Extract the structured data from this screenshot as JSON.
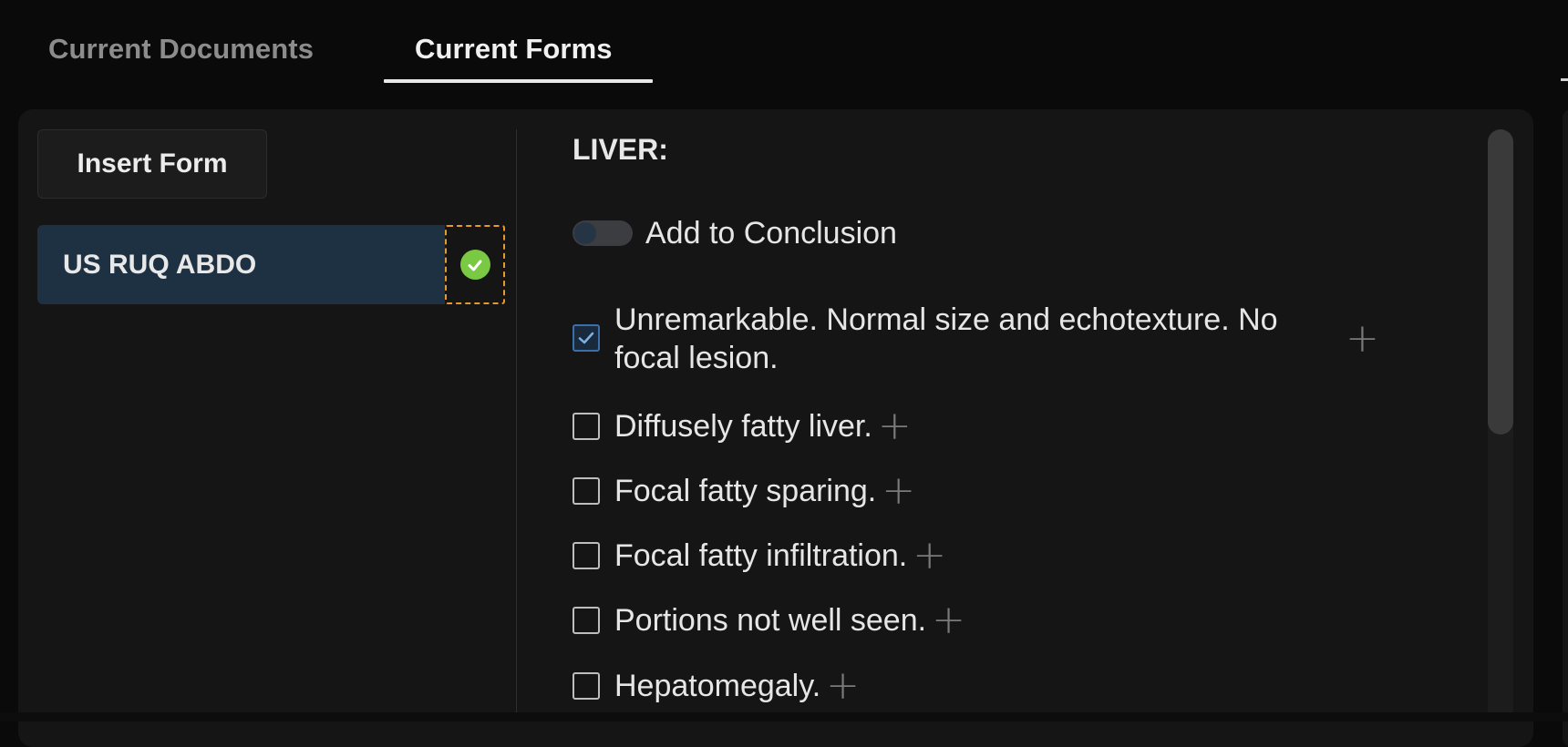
{
  "tabs": [
    {
      "label": "Current Documents",
      "active": false
    },
    {
      "label": "Current Forms",
      "active": true
    }
  ],
  "forms_panel": {
    "insert_button_label": "Insert Form",
    "forms": [
      {
        "name": "US RUQ ABDO",
        "status": "complete",
        "selected": true
      }
    ]
  },
  "form_content": {
    "section_title": "LIVER:",
    "toggle": {
      "label": "Add to Conclusion",
      "on": false
    },
    "options": [
      {
        "label": "Unremarkable. Normal size and echotexture. No focal lesion.",
        "checked": true
      },
      {
        "label": "Diffusely fatty liver.",
        "checked": false
      },
      {
        "label": "Focal fatty sparing.",
        "checked": false
      },
      {
        "label": "Focal fatty infiltration.",
        "checked": false
      },
      {
        "label": "Portions not well seen.",
        "checked": false
      },
      {
        "label": "Hepatomegaly.",
        "checked": false
      }
    ]
  },
  "icons": {
    "status": "check-circle-icon",
    "add": "plus-icon",
    "check": "checkmark-icon"
  },
  "colors": {
    "selected_form_bg": "#1e3142",
    "status_green": "#7ac943",
    "focus_outline": "#e69a2e",
    "checkbox_checked": "#3b6fa8"
  }
}
